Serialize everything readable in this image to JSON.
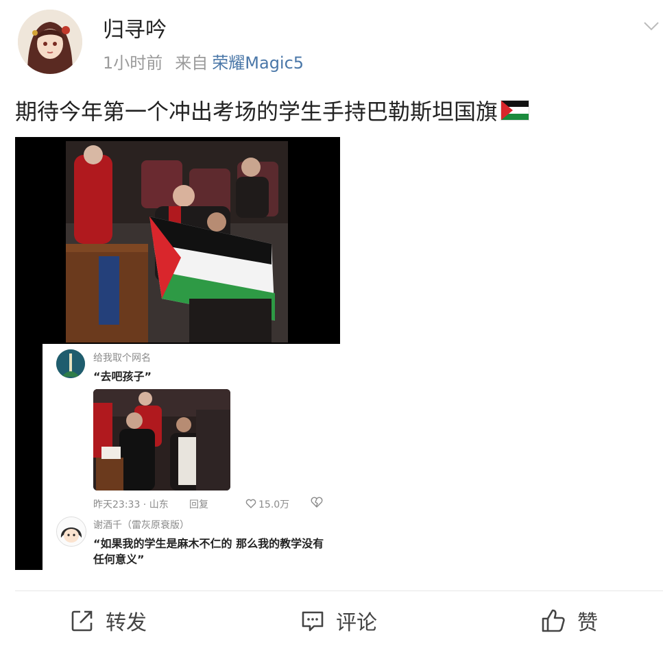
{
  "post": {
    "username": "归寻吟",
    "time": "1小时前",
    "from_label": "来自",
    "device": "荣耀Magic5",
    "text": "期待今年第一个冲出考场的学生手持巴勒斯坦国旗"
  },
  "video": {
    "comment1": {
      "name": "给我取个网名",
      "text": "“去吧孩子”",
      "time_location": "昨天23:33 · 山东",
      "reply_label": "回复",
      "likes": "15.0万"
    },
    "comment2": {
      "name": "谢酒千（雷灰原衰版）",
      "text": "“如果我的学生是麻木不仁的 那么我的教学没有任何意义”"
    }
  },
  "actions": {
    "repost": "转发",
    "comment": "评论",
    "like": "赞"
  },
  "icons": {
    "chevron": "chevron-down-icon",
    "flag": "palestine-flag-icon",
    "repost": "share-icon",
    "comment": "comment-icon",
    "like": "thumbs-up-icon"
  },
  "colors": {
    "device_link": "#4a77a8",
    "meta_gray": "#9a9a9a"
  }
}
